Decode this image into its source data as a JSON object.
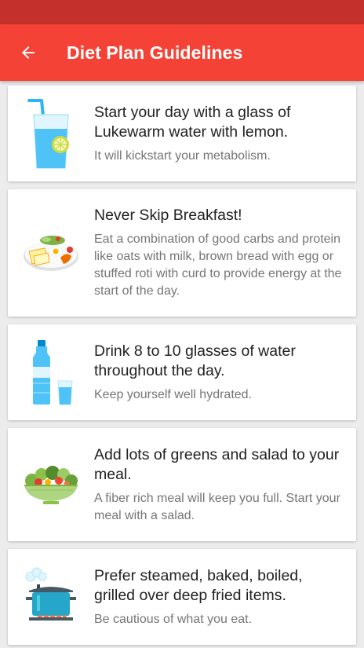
{
  "app_bar": {
    "title": "Diet Plan Guidelines",
    "back_icon": "arrow-back-icon"
  },
  "colors": {
    "status_bar": "#c4302b",
    "app_bar": "#f44336",
    "background": "#ececec",
    "card": "#ffffff",
    "title_text": "#212121",
    "desc_text": "#757575"
  },
  "guidelines": [
    {
      "icon": "water-glass-lemon-icon",
      "title": "Start your day with a glass of Lukewarm water with lemon.",
      "description": "It will kickstart your metabolism."
    },
    {
      "icon": "breakfast-plate-icon",
      "title": "Never Skip Breakfast!",
      "description": "Eat a combination of good carbs and protein like oats with milk, brown bread with egg or stuffed roti with curd to provide energy at the start of the day."
    },
    {
      "icon": "water-bottle-glass-icon",
      "title": "Drink 8 to 10 glasses of water throughout the day.",
      "description": "Keep yourself well hydrated."
    },
    {
      "icon": "salad-bowl-icon",
      "title": "Add lots of greens and salad to your meal.",
      "description": "A fiber rich meal will keep you full. Start your meal with a salad."
    },
    {
      "icon": "steaming-pot-icon",
      "title": "Prefer steamed, baked, boiled, grilled over deep fried items.",
      "description": "Be cautious of what you eat."
    }
  ]
}
